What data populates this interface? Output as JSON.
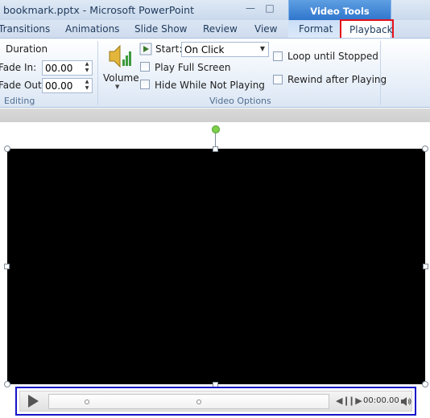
{
  "window": {
    "title": "bookmark.pptx  -  Microsoft PowerPoint",
    "context_tab_group": "Video Tools"
  },
  "tabs": {
    "transitions": "Transitions",
    "animations": "Animations",
    "slide_show": "Slide Show",
    "review": "Review",
    "view": "View",
    "format": "Format",
    "playback": "Playback",
    "active": "Playback",
    "highlight_color": "#e4121a"
  },
  "ribbon": {
    "editing": {
      "duration_label": "Duration",
      "fade_in_label": "Fade In:",
      "fade_in_value": "00.00",
      "fade_out_label": "Fade Out:",
      "fade_out_value": "00.00",
      "group_label": "Editing"
    },
    "video_options": {
      "volume_label": "Volume",
      "start_label": "Start:",
      "start_value": "On Click",
      "play_full_screen": "Play Full Screen",
      "hide_while_not_playing": "Hide While Not Playing",
      "loop_until_stopped": "Loop until Stopped",
      "rewind_after_playing": "Rewind after Playing",
      "group_label": "Video Options"
    }
  },
  "video": {
    "background_color": "#000000"
  },
  "media_controls": {
    "time": "00:00.00",
    "highlight_color": "#1414c8",
    "bookmark_count": 2,
    "icons": [
      "play-icon",
      "previous-icon",
      "next-icon",
      "volume-icon"
    ]
  }
}
